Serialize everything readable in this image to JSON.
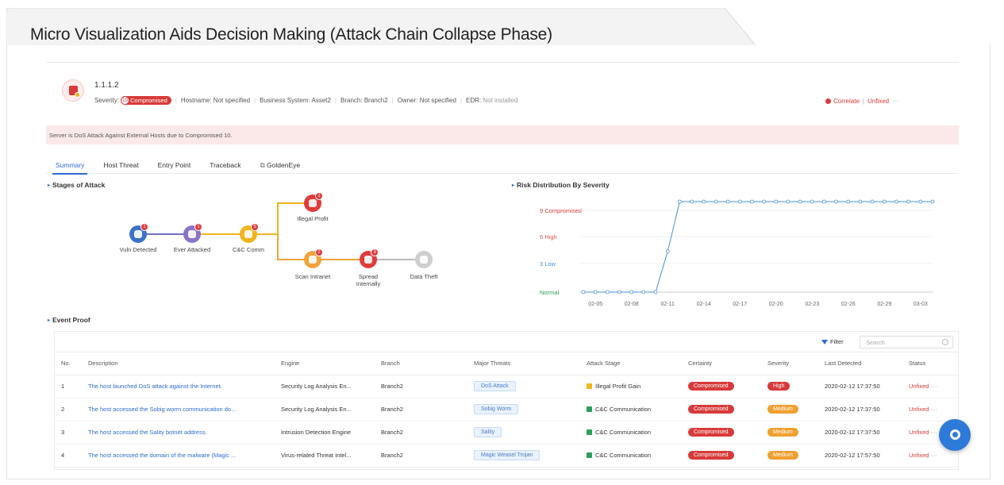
{
  "slide_title": "Micro Visualization Aids Decision Making (Attack Chain Collapse Phase)",
  "asset": {
    "ip": "1.1.1.2",
    "severity_label": "Severity:",
    "severity_count": "10",
    "severity_value": "Compromised",
    "hostname": "Hostname: Not specified",
    "business_system": "Business System: Asset2",
    "branch": "Branch: Branch2",
    "owner": "Owner: Not specified",
    "edr_label": "EDR:",
    "edr_value": "Not installed",
    "correlate": "Correlate",
    "status": "Unfixed",
    "more": "···"
  },
  "alert": "Server is DoS Attack Against External Hosts due to Compromised 10.",
  "tabs": [
    "Summary",
    "Host Threat",
    "Entry Point",
    "Traceback",
    "GoldenEye"
  ],
  "sections": {
    "stages": "Stages of Attack",
    "risk": "Risk Distribution By Severity",
    "events": "Event Proof"
  },
  "stages": [
    {
      "label": "Vuln Detected",
      "badge": "1",
      "color": "#3c72c9"
    },
    {
      "label": "Ever Attacked",
      "badge": "1",
      "color": "#8a74c8"
    },
    {
      "label": "C&C Comm",
      "badge": "5",
      "color": "#f2b31c"
    },
    {
      "label": "Illegal Profit",
      "badge": "1",
      "color": "#e03b3b"
    },
    {
      "label": "Scan Intranet",
      "badge": "2",
      "color": "#f2a23a"
    },
    {
      "label": "Spread Internally",
      "badge": "3",
      "color": "#e03b3b"
    },
    {
      "label": "Data Theft",
      "badge": "",
      "color": "#cfcfcf"
    }
  ],
  "chart_data": {
    "type": "line",
    "title": "Risk Distribution By Severity",
    "y_levels": [
      "Normal",
      "3 Low",
      "6 High",
      "9 Compromised"
    ],
    "y_colors": [
      "#2aa05a",
      "#3c8fd6",
      "#e05050",
      "#d83a3a"
    ],
    "x_ticks": [
      "02-05",
      "02-08",
      "02-11",
      "02-14",
      "02-17",
      "02-20",
      "02-23",
      "02-26",
      "02-29",
      "03-03"
    ],
    "series": [
      {
        "x": [
          "02-04",
          "02-05",
          "02-06",
          "02-07",
          "02-08",
          "02-09",
          "02-10",
          "02-11",
          "02-12",
          "02-13",
          "02-14",
          "02-15",
          "02-16",
          "02-17",
          "02-18",
          "02-19",
          "02-20",
          "02-21",
          "02-22",
          "02-23",
          "02-24",
          "02-25",
          "02-26",
          "02-27",
          "02-28",
          "02-29",
          "03-01",
          "03-02",
          "03-03",
          "03-04"
        ],
        "y": [
          0,
          0,
          0,
          0,
          0,
          0,
          0,
          4.5,
          10,
          10,
          10,
          10,
          10,
          10,
          10,
          10,
          10,
          10,
          10,
          10,
          10,
          10,
          10,
          10,
          10,
          10,
          10,
          10,
          10,
          10
        ],
        "color": "#4a90d9"
      }
    ],
    "ylim": [
      0,
      10
    ]
  },
  "table": {
    "filter": "Filter",
    "search_placeholder": "Search",
    "headers": [
      "No.",
      "Description",
      "Engine",
      "Branch",
      "Major Threats",
      "Attack Stage",
      "Certainty",
      "Severity",
      "Last Detected",
      "Status"
    ],
    "rows": [
      {
        "no": "1",
        "desc": "The host launched DoS attack against the Internet.",
        "engine": "Security Log Analysis En...",
        "branch": "Branch2",
        "threat": "DoS Attack",
        "stage": "Illegal Profit Gain",
        "stage_color": "#f2b31c",
        "certainty": "Compromised",
        "severity": "High",
        "severity_class": "red",
        "detected": "2020-02-12 17:37:50",
        "status": "Unfixed"
      },
      {
        "no": "2",
        "desc": "The host accessed the Sobig worm communication do...",
        "engine": "Security Log Analysis En...",
        "branch": "Branch2",
        "threat": "Sobig Worm",
        "stage": "C&C Communication",
        "stage_color": "#2aa05a",
        "certainty": "Compromised",
        "severity": "Medium",
        "severity_class": "orange",
        "detected": "2020-02-12 17:37:50",
        "status": "Unfixed"
      },
      {
        "no": "3",
        "desc": "The host accessed the Sality botnet address.",
        "engine": "Intrusion Detection Engine",
        "branch": "Branch2",
        "threat": "Sality",
        "stage": "C&C Communication",
        "stage_color": "#2aa05a",
        "certainty": "Compromised",
        "severity": "Medium",
        "severity_class": "orange",
        "detected": "2020-02-12 17:37:50",
        "status": "Unfixed"
      },
      {
        "no": "4",
        "desc": "The host accessed the domain of the malware (Magic ...",
        "engine": "Virus-related Threat Intel...",
        "branch": "Branch2",
        "threat": "Magic Weasel Trojan",
        "stage": "C&C Communication",
        "stage_color": "#2aa05a",
        "certainty": "Compromised",
        "severity": "Medium",
        "severity_class": "orange",
        "detected": "2020-02-12 17:57:50",
        "status": "Unfixed"
      }
    ]
  }
}
